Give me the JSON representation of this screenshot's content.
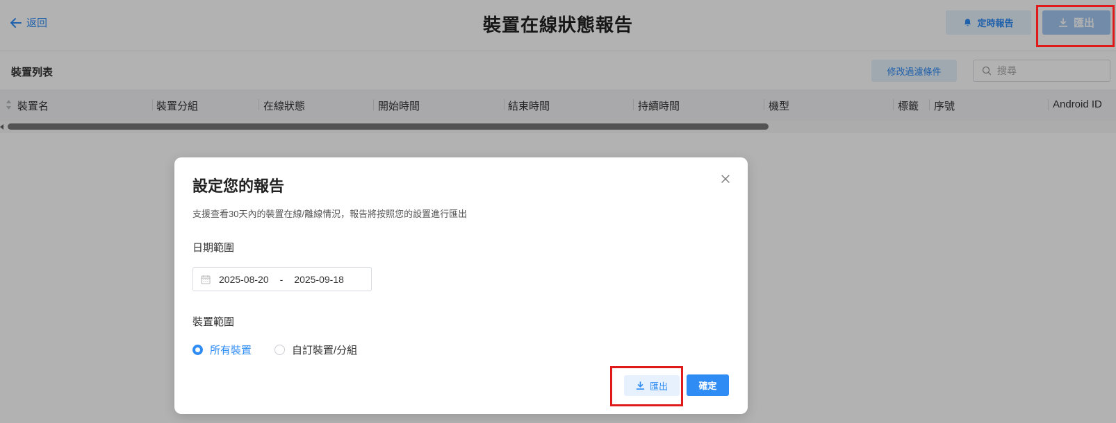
{
  "header": {
    "back_label": "返回",
    "title": "裝置在線狀態報告",
    "schedule_label": "定時報告",
    "export_label": "匯出"
  },
  "toolbar": {
    "title": "裝置列表",
    "filter_label": "修改過濾條件",
    "search_placeholder": "搜尋"
  },
  "table": {
    "columns": [
      "裝置名",
      "裝置分組",
      "在線狀態",
      "開始時間",
      "結束時間",
      "持續時間",
      "機型",
      "標籤",
      "序號",
      "Android ID"
    ]
  },
  "modal": {
    "title": "設定您的報告",
    "description": "支援查看30天內的裝置在線/離線情況，報告將按照您的設置進行匯出",
    "date_label": "日期範圍",
    "date_start": "2025-08-20",
    "date_separator": "-",
    "date_end": "2025-09-18",
    "device_label": "裝置範圍",
    "options": [
      {
        "label": "所有裝置",
        "checked": true
      },
      {
        "label": "自訂裝置/分組",
        "checked": false
      }
    ],
    "export_label": "匯出",
    "confirm_label": "確定"
  },
  "colors": {
    "accent": "#2f8cf5",
    "highlight": "#e01a1a",
    "overlay": "rgba(0,0,0,0.30)"
  },
  "icons": [
    "arrow-left-icon",
    "bell-icon",
    "download-icon",
    "search-icon",
    "sort-icon",
    "calendar-icon",
    "close-icon"
  ]
}
